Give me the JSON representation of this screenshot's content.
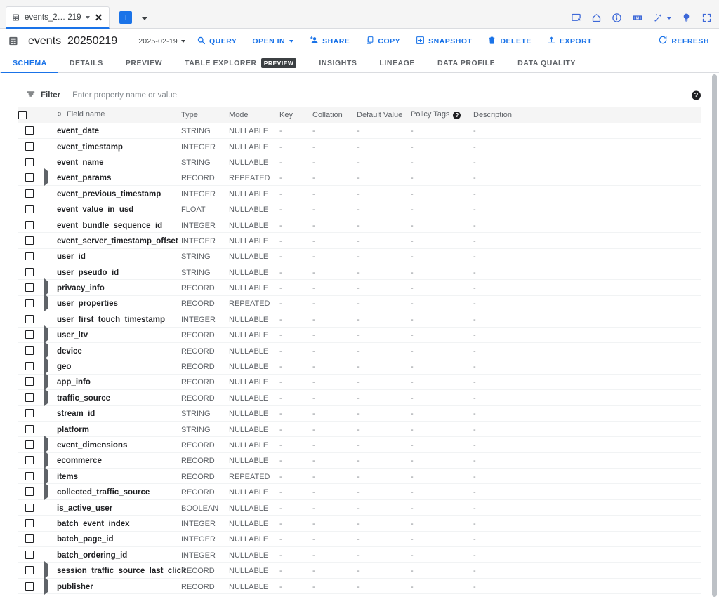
{
  "tabstrip": {
    "tab_label": "events_2… 219",
    "tab_icon": "table-icon",
    "close_icon": "✕",
    "new_tab_icon": "+",
    "right_icons": [
      {
        "name": "open-new-window-icon"
      },
      {
        "name": "home-icon"
      },
      {
        "name": "info-icon"
      },
      {
        "name": "keyboard-icon"
      },
      {
        "name": "magic-wand-icon"
      },
      {
        "name": "lightbulb-icon"
      },
      {
        "name": "fullscreen-icon"
      }
    ]
  },
  "header": {
    "table_icon": "table-icon",
    "title": "events_20250219",
    "date_selector": "2025-02-19",
    "actions": [
      {
        "name": "query-button",
        "label": "QUERY",
        "icon": "search-icon"
      },
      {
        "name": "open-in-button",
        "label": "OPEN IN",
        "icon": "none"
      },
      {
        "name": "share-button",
        "label": "SHARE",
        "icon": "person-add-icon"
      },
      {
        "name": "copy-button",
        "label": "COPY",
        "icon": "copy-icon"
      },
      {
        "name": "snapshot-button",
        "label": "SNAPSHOT",
        "icon": "snapshot-icon"
      },
      {
        "name": "delete-button",
        "label": "DELETE",
        "icon": "trash-icon"
      },
      {
        "name": "export-button",
        "label": "EXPORT",
        "icon": "upload-icon"
      }
    ],
    "refresh_label": "REFRESH"
  },
  "nav_tabs": [
    {
      "label": "SCHEMA",
      "active": true,
      "badge": ""
    },
    {
      "label": "DETAILS",
      "active": false,
      "badge": ""
    },
    {
      "label": "PREVIEW",
      "active": false,
      "badge": ""
    },
    {
      "label": "TABLE EXPLORER",
      "active": false,
      "badge": "PREVIEW"
    },
    {
      "label": "INSIGHTS",
      "active": false,
      "badge": ""
    },
    {
      "label": "LINEAGE",
      "active": false,
      "badge": ""
    },
    {
      "label": "DATA PROFILE",
      "active": false,
      "badge": ""
    },
    {
      "label": "DATA QUALITY",
      "active": false,
      "badge": ""
    }
  ],
  "filter": {
    "label": "Filter",
    "placeholder": "Enter property name or value",
    "value": "",
    "help_icon": "?"
  },
  "table": {
    "columns": [
      "Field name",
      "Type",
      "Mode",
      "Key",
      "Collation",
      "Default Value",
      "Policy Tags",
      "Description"
    ],
    "policy_tags_help": "?",
    "empty_value": "-",
    "rows": [
      {
        "name": "event_date",
        "type": "STRING",
        "mode": "NULLABLE",
        "expandable": false
      },
      {
        "name": "event_timestamp",
        "type": "INTEGER",
        "mode": "NULLABLE",
        "expandable": false
      },
      {
        "name": "event_name",
        "type": "STRING",
        "mode": "NULLABLE",
        "expandable": false
      },
      {
        "name": "event_params",
        "type": "RECORD",
        "mode": "REPEATED",
        "expandable": true
      },
      {
        "name": "event_previous_timestamp",
        "type": "INTEGER",
        "mode": "NULLABLE",
        "expandable": false
      },
      {
        "name": "event_value_in_usd",
        "type": "FLOAT",
        "mode": "NULLABLE",
        "expandable": false
      },
      {
        "name": "event_bundle_sequence_id",
        "type": "INTEGER",
        "mode": "NULLABLE",
        "expandable": false
      },
      {
        "name": "event_server_timestamp_offset",
        "type": "INTEGER",
        "mode": "NULLABLE",
        "expandable": false
      },
      {
        "name": "user_id",
        "type": "STRING",
        "mode": "NULLABLE",
        "expandable": false
      },
      {
        "name": "user_pseudo_id",
        "type": "STRING",
        "mode": "NULLABLE",
        "expandable": false
      },
      {
        "name": "privacy_info",
        "type": "RECORD",
        "mode": "NULLABLE",
        "expandable": true
      },
      {
        "name": "user_properties",
        "type": "RECORD",
        "mode": "REPEATED",
        "expandable": true
      },
      {
        "name": "user_first_touch_timestamp",
        "type": "INTEGER",
        "mode": "NULLABLE",
        "expandable": false
      },
      {
        "name": "user_ltv",
        "type": "RECORD",
        "mode": "NULLABLE",
        "expandable": true
      },
      {
        "name": "device",
        "type": "RECORD",
        "mode": "NULLABLE",
        "expandable": true
      },
      {
        "name": "geo",
        "type": "RECORD",
        "mode": "NULLABLE",
        "expandable": true
      },
      {
        "name": "app_info",
        "type": "RECORD",
        "mode": "NULLABLE",
        "expandable": true
      },
      {
        "name": "traffic_source",
        "type": "RECORD",
        "mode": "NULLABLE",
        "expandable": true
      },
      {
        "name": "stream_id",
        "type": "STRING",
        "mode": "NULLABLE",
        "expandable": false
      },
      {
        "name": "platform",
        "type": "STRING",
        "mode": "NULLABLE",
        "expandable": false
      },
      {
        "name": "event_dimensions",
        "type": "RECORD",
        "mode": "NULLABLE",
        "expandable": true
      },
      {
        "name": "ecommerce",
        "type": "RECORD",
        "mode": "NULLABLE",
        "expandable": true
      },
      {
        "name": "items",
        "type": "RECORD",
        "mode": "REPEATED",
        "expandable": true
      },
      {
        "name": "collected_traffic_source",
        "type": "RECORD",
        "mode": "NULLABLE",
        "expandable": true
      },
      {
        "name": "is_active_user",
        "type": "BOOLEAN",
        "mode": "NULLABLE",
        "expandable": false
      },
      {
        "name": "batch_event_index",
        "type": "INTEGER",
        "mode": "NULLABLE",
        "expandable": false
      },
      {
        "name": "batch_page_id",
        "type": "INTEGER",
        "mode": "NULLABLE",
        "expandable": false
      },
      {
        "name": "batch_ordering_id",
        "type": "INTEGER",
        "mode": "NULLABLE",
        "expandable": false
      },
      {
        "name": "session_traffic_source_last_click",
        "type": "RECORD",
        "mode": "NULLABLE",
        "expandable": true
      },
      {
        "name": "publisher",
        "type": "RECORD",
        "mode": "NULLABLE",
        "expandable": true
      }
    ]
  },
  "colors": {
    "accent": "#1a73e8",
    "text_primary": "#202124",
    "text_secondary": "#5f6368",
    "border": "#dadce0",
    "header_bg": "#f5f5f5"
  }
}
